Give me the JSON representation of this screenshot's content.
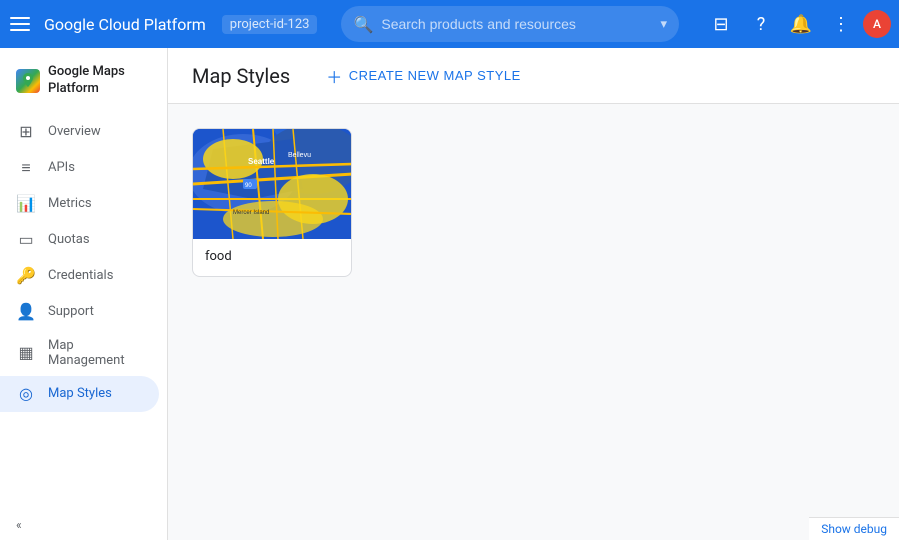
{
  "topbar": {
    "title": "Google Cloud Platform",
    "project": "project-id-123",
    "search_placeholder": "Search products and resources",
    "menu_icon": "☰",
    "dropdown_icon": "▾"
  },
  "sidebar": {
    "app_name": "Google Maps Platform",
    "items": [
      {
        "id": "overview",
        "label": "Overview",
        "icon": "⊞"
      },
      {
        "id": "apis",
        "label": "APIs",
        "icon": "≡"
      },
      {
        "id": "metrics",
        "label": "Metrics",
        "icon": "↑"
      },
      {
        "id": "quotas",
        "label": "Quotas",
        "icon": "▭"
      },
      {
        "id": "credentials",
        "label": "Credentials",
        "icon": "🔑"
      },
      {
        "id": "support",
        "label": "Support",
        "icon": "👤"
      },
      {
        "id": "map-management",
        "label": "Map Management",
        "icon": "▦"
      },
      {
        "id": "map-styles",
        "label": "Map Styles",
        "icon": "◎",
        "active": true
      }
    ],
    "collapse_label": "«"
  },
  "main": {
    "title": "Map Styles",
    "create_button_label": "CREATE NEW MAP STYLE",
    "create_button_icon": "+"
  },
  "map_styles": [
    {
      "id": "food",
      "label": "food"
    }
  ],
  "debug_bar": {
    "label": "Show debug"
  }
}
